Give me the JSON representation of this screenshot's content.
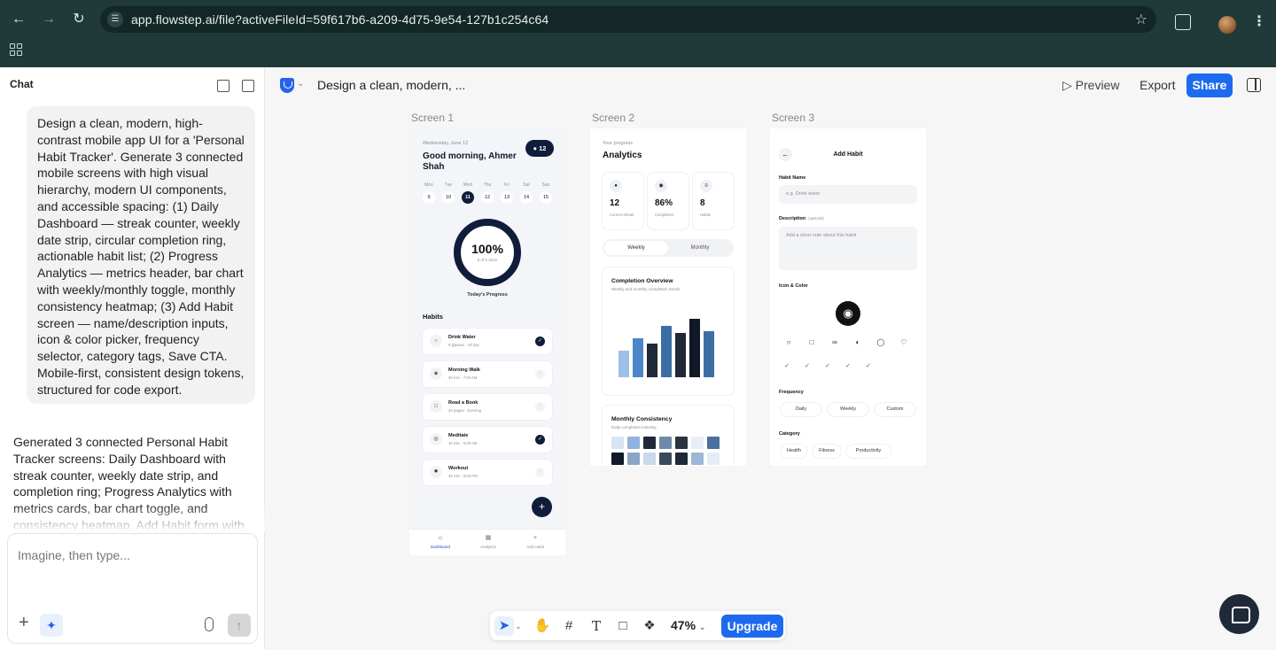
{
  "browser": {
    "url": "app.flowstep.ai/file?activeFileId=59f617b6-a209-4d75-9e54-127b1c254c64"
  },
  "chat": {
    "title": "Chat",
    "user_message": "Design a clean, modern, high-contrast mobile app UI for a 'Personal Habit Tracker'. Generate 3 connected mobile screens with high visual hierarchy, modern UI components, and accessible spacing: (1) Daily Dashboard — streak counter, weekly date strip, circular completion ring, actionable habit list; (2) Progress Analytics — metrics header, bar chart with weekly/monthly toggle, monthly consistency heatmap; (3) Add Habit screen — name/description inputs, icon & color picker, frequency selector, category tags, Save CTA. Mobile-first, consistent design tokens, structured for code export.",
    "assistant_message": "Generated 3 connected Personal Habit Tracker screens: Daily Dashboard with streak counter, weekly date strip, and completion ring; Progress Analytics with metrics cards, bar chart toggle, and consistency heatmap, Add Habit form with",
    "input_placeholder": "Imagine, then type..."
  },
  "toolbar": {
    "project_title": "Design a clean, modern, ...",
    "preview_label": "Preview",
    "export_label": "Export",
    "share_label": "Share"
  },
  "screens": {
    "labels": [
      "Screen 1",
      "Screen 2",
      "Screen 3"
    ],
    "s1": {
      "date": "Wednesday, June 12",
      "greeting": "Good morning, Ahmer Shah",
      "streak": "12",
      "days": [
        {
          "name": "Mon",
          "num": "9"
        },
        {
          "name": "Tue",
          "num": "10"
        },
        {
          "name": "Wed",
          "num": "11"
        },
        {
          "name": "Thu",
          "num": "12"
        },
        {
          "name": "Fri",
          "num": "13"
        },
        {
          "name": "Sat",
          "num": "14"
        },
        {
          "name": "Sun",
          "num": "15"
        }
      ],
      "ring_pct": "100%",
      "ring_sub": "5 of 5 done",
      "today_label": "Today's Progress",
      "habits_title": "Habits",
      "habits": [
        {
          "name": "Drink Water",
          "sub": "8 glasses · All day",
          "done": true
        },
        {
          "name": "Morning Walk",
          "sub": "30 min · 7:00 AM",
          "done": false
        },
        {
          "name": "Read a Book",
          "sub": "20 pages · Evening",
          "done": false
        },
        {
          "name": "Meditate",
          "sub": "10 min · 6:30 AM",
          "done": true
        },
        {
          "name": "Workout",
          "sub": "45 min · 6:00 PM",
          "done": false
        }
      ],
      "tabs": [
        "Dashboard",
        "Analytics",
        "Add Habit"
      ]
    },
    "s2": {
      "kicker": "Your progress",
      "title": "Analytics",
      "metrics": [
        {
          "value": "12",
          "label": "Current Streak"
        },
        {
          "value": "86%",
          "label": "Completion"
        },
        {
          "value": "8",
          "label": "Habits"
        }
      ],
      "toggle": [
        "Weekly",
        "Monthly"
      ],
      "overview_title": "Completion Overview",
      "overview_sub": "Weekly and monthly completion trends",
      "consistency_title": "Monthly Consistency",
      "consistency_sub": "Daily completion intensity"
    },
    "s3": {
      "title": "Add Habit",
      "name_label": "Habit Name",
      "name_placeholder": "e.g. Drink water",
      "desc_label": "Description",
      "desc_optional": "(optional)",
      "desc_placeholder": "Add a short note about this habit",
      "icon_label": "Icon & Color",
      "frequency_label": "Frequency",
      "frequency": [
        "Daily",
        "Weekly",
        "Custom"
      ],
      "category_label": "Category",
      "categories": [
        "Health",
        "Fitness",
        "Productivity"
      ]
    }
  },
  "bottom_toolbar": {
    "zoom": "47%",
    "upgrade_label": "Upgrade"
  },
  "chart_data": {
    "type": "bar",
    "values": [
      30,
      44,
      38,
      58,
      50,
      66,
      52
    ],
    "colors": [
      "#9cc0e8",
      "#4a86c8",
      "#1f2937",
      "#3b6ea5",
      "#1f2937",
      "#111827",
      "#3b6ea5"
    ]
  },
  "heatmap": {
    "colors": [
      "#d6e4f5",
      "#8fb3dd",
      "#1f2937",
      "#6e8aab",
      "#2b3440",
      "#e7eef7",
      "#4a6fa0",
      "#111827",
      "#8aa5c4",
      "#c9d8ea",
      "#3d4a5a",
      "#1f2937",
      "#9cb7d6",
      "#e6ecf3"
    ]
  },
  "colors": {
    "accent": "#1d6af0",
    "navy": "#0f1c3a"
  }
}
